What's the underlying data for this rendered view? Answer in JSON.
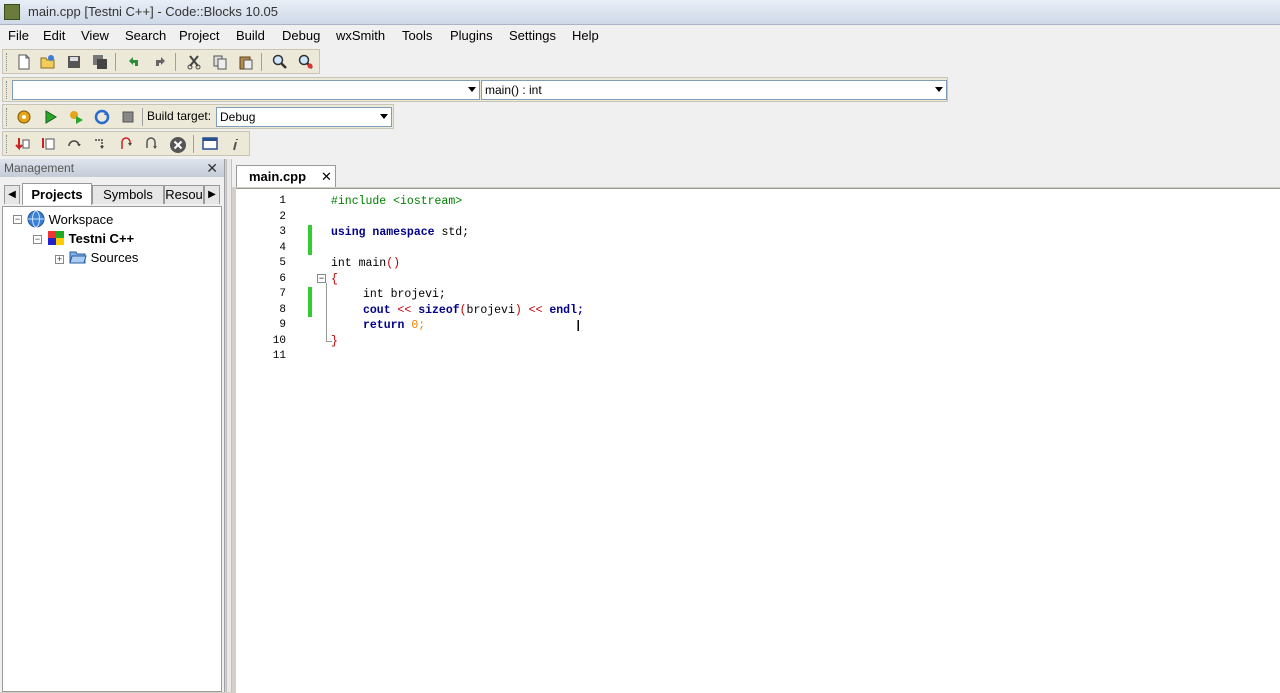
{
  "window": {
    "title": "main.cpp [Testni C++] - Code::Blocks 10.05"
  },
  "menu": [
    "File",
    "Edit",
    "View",
    "Search",
    "Project",
    "Build",
    "Debug",
    "wxSmith",
    "Tools",
    "Plugins",
    "Settings",
    "Help"
  ],
  "toolbar": {
    "scope_combo_value": "",
    "function_combo_value": "main() : int",
    "build_target_label": "Build target:",
    "build_target_value": "Debug"
  },
  "management": {
    "header": "Management",
    "tabs": [
      "Projects",
      "Symbols",
      "Resou"
    ],
    "active_tab": "Projects",
    "tree": {
      "workspace": "Workspace",
      "project": "Testni C++",
      "folder": "Sources"
    }
  },
  "editor": {
    "tab": "main.cpp",
    "line_numbers": [
      "1",
      "2",
      "3",
      "4",
      "5",
      "6",
      "7",
      "8",
      "9",
      "10",
      "11"
    ],
    "code": {
      "l1": "#include <iostream>",
      "l3_kw1": "using",
      "l3_kw2": "namespace",
      "l3_rest": " std;",
      "l5": "int main",
      "l5_paren": "()",
      "l6": "{",
      "l7_kw": "int",
      "l7_rest": " brojevi;",
      "l8_a": "cout",
      "l8_op1": " << ",
      "l8_kw": "sizeof",
      "l8_paren1": "(",
      "l8_arg": "brojevi",
      "l8_paren2": ")",
      "l8_op2": " << ",
      "l8_b": "endl;",
      "l9_kw": "return",
      "l9_num": " 0;",
      "l10": "}"
    }
  },
  "colors": {
    "change_marker": "#33cc33",
    "keyword": "#00008b",
    "preprocessor": "#008000",
    "number": "#f08000",
    "operator": "#c00000"
  },
  "icons": [
    "new-file-icon",
    "open-icon",
    "save-icon",
    "save-all-icon",
    "undo-icon",
    "redo-icon",
    "cut-icon",
    "copy-icon",
    "paste-icon",
    "find-icon",
    "replace-icon",
    "build-icon",
    "run-icon",
    "build-run-icon",
    "rebuild-icon",
    "abort-icon",
    "debug-icon"
  ]
}
